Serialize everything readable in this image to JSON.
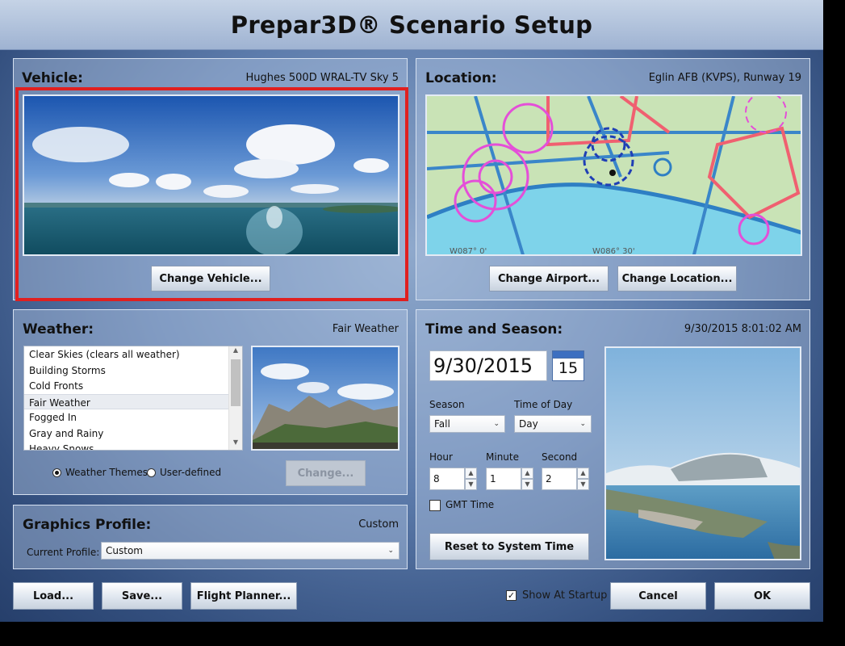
{
  "window": {
    "title": "Prepar3D® Scenario Setup"
  },
  "vehicle": {
    "heading": "Vehicle:",
    "value": "Hughes 500D WRAL-TV Sky 5",
    "change_button": "Change Vehicle..."
  },
  "location": {
    "heading": "Location:",
    "value": "Eglin AFB (KVPS), Runway 19",
    "change_airport_button": "Change Airport...",
    "change_location_button": "Change Location...",
    "map_labels": [
      "W087° 0'",
      "W086° 30'"
    ]
  },
  "weather": {
    "heading": "Weather:",
    "value": "Fair Weather",
    "themes": [
      "Clear Skies (clears all weather)",
      "Building Storms",
      "Cold Fronts",
      "Fair Weather",
      "Fogged In",
      "Gray and Rainy",
      "Heavy Snows"
    ],
    "selected_theme": "Fair Weather",
    "radio_themes": "Weather Themes",
    "radio_user": "User-defined",
    "change_button": "Change..."
  },
  "graphics": {
    "heading": "Graphics Profile:",
    "value": "Custom",
    "current_profile_label": "Current Profile:",
    "current_profile": "Custom"
  },
  "time": {
    "heading": "Time and Season:",
    "value": "9/30/2015 8:01:02 AM",
    "date": "9/30/2015",
    "calendar_day": "15",
    "season_label": "Season",
    "season": "Fall",
    "tod_label": "Time of Day",
    "tod": "Day",
    "hour_label": "Hour",
    "hour": "8",
    "minute_label": "Minute",
    "minute": "1",
    "second_label": "Second",
    "second": "2",
    "gmt_label": "GMT Time",
    "reset_button": "Reset to System Time"
  },
  "footer": {
    "load_button": "Load...",
    "save_button": "Save...",
    "planner_button": "Flight Planner...",
    "show_startup_label": "Show At Startup",
    "cancel_button": "Cancel",
    "ok_button": "OK"
  },
  "colors": {
    "highlight_border": "#e02020",
    "panel_border": "#d5e0f0",
    "accent": "#5d7cac"
  }
}
